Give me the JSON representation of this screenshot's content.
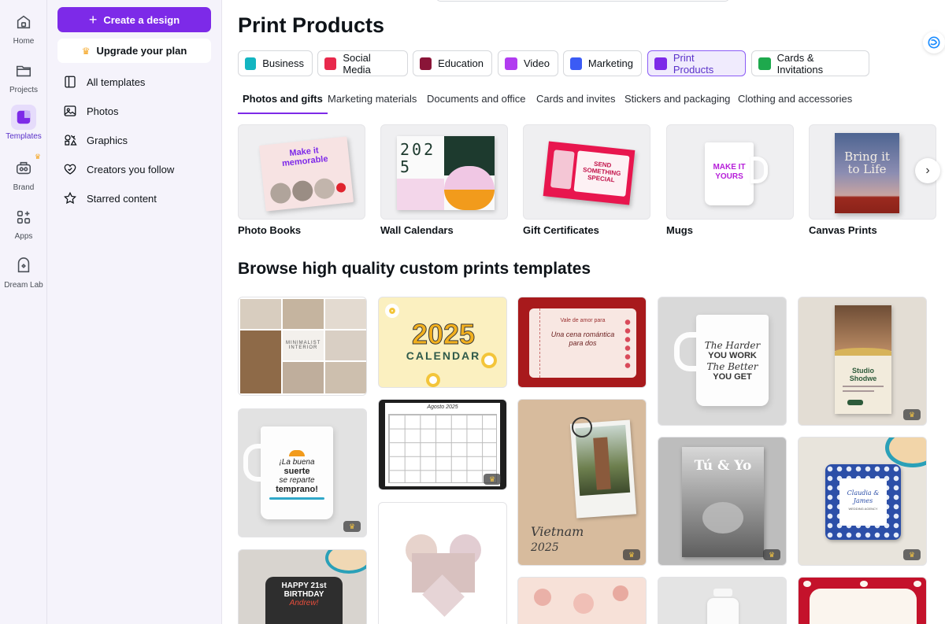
{
  "rail": {
    "items": [
      {
        "label": "Home",
        "icon": "home-icon"
      },
      {
        "label": "Projects",
        "icon": "folder-icon"
      },
      {
        "label": "Templates",
        "icon": "templates-icon"
      },
      {
        "label": "Brand",
        "icon": "brand-icon"
      },
      {
        "label": "Apps",
        "icon": "apps-icon"
      },
      {
        "label": "Dream Lab",
        "icon": "dream-lab-icon"
      }
    ],
    "active": "Templates"
  },
  "panel": {
    "create_label": "Create a design",
    "upgrade_label": "Upgrade your plan",
    "nav": [
      {
        "label": "All templates",
        "icon": "layout-icon"
      },
      {
        "label": "Photos",
        "icon": "image-icon"
      },
      {
        "label": "Graphics",
        "icon": "shapes-icon"
      },
      {
        "label": "Creators you follow",
        "icon": "heart-icon"
      },
      {
        "label": "Starred content",
        "icon": "star-icon"
      }
    ]
  },
  "main": {
    "title": "Print Products",
    "chips": [
      {
        "label": "Business",
        "color": "#13b5c1"
      },
      {
        "label": "Social Media",
        "color": "#e8294c"
      },
      {
        "label": "Education",
        "color": "#8a1538"
      },
      {
        "label": "Video",
        "color": "#b13cf0"
      },
      {
        "label": "Marketing",
        "color": "#3b5bf5"
      },
      {
        "label": "Print Products",
        "color": "#7d2ae8"
      },
      {
        "label": "Cards & Invitations",
        "color": "#1ea94d"
      }
    ],
    "active_chip": "Print Products",
    "subtabs": [
      "Photos and gifts",
      "Marketing materials",
      "Documents and office",
      "Cards and invites",
      "Stickers and packaging",
      "Clothing and accessories"
    ],
    "active_subtab": "Photos and gifts",
    "categories": [
      {
        "label": "Photo Books",
        "thumb_text": "Make it memorable"
      },
      {
        "label": "Wall Calendars",
        "thumb_text": "2025"
      },
      {
        "label": "Gift Certificates",
        "thumb_text": "SEND SOMETHING SPECIAL"
      },
      {
        "label": "Mugs",
        "thumb_text": "MAKE IT YOURS"
      },
      {
        "label": "Canvas Prints",
        "thumb_text": "Bring it to Life"
      }
    ],
    "browse_title": "Browse high quality custom prints templates",
    "templates": {
      "t1": "MINIMALIST INTERIOR",
      "t2a": "2025",
      "t2b": "CALENDAR",
      "t3a": "Vale de amor para",
      "t3b": "Una cena romántica para dos",
      "t4a": "The Harder",
      "t4b": "YOU WORK",
      "t4c": "The Better",
      "t4d": "YOU GET",
      "t5a": "Studio Shodwe",
      "t6a": "¡La buena",
      "t6b": "suerte",
      "t6c": "se reparte",
      "t6d": "temprano!",
      "t7a": "Agosto 2025",
      "t8a": "Vietnam",
      "t8b": "2025",
      "t9a": "Tú & Yo",
      "t10a": "Claudia & James",
      "t10b": "WEDDING AGENCY",
      "t11a": "HAPPY 21st BIRTHDAY",
      "t11b": "Andrew!"
    }
  }
}
